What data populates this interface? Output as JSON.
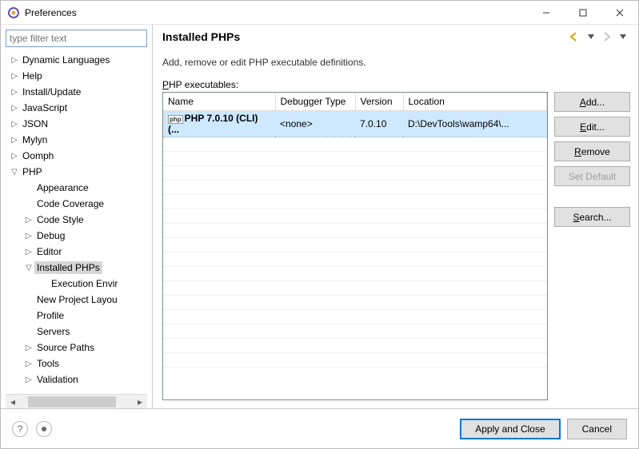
{
  "window": {
    "title": "Preferences"
  },
  "filter": {
    "placeholder": "type filter text"
  },
  "tree": {
    "dynamic_languages": "Dynamic Languages",
    "help": "Help",
    "install_update": "Install/Update",
    "javascript": "JavaScript",
    "json": "JSON",
    "mylyn": "Mylyn",
    "oomph": "Oomph",
    "php": "PHP",
    "appearance": "Appearance",
    "code_coverage": "Code Coverage",
    "code_style": "Code Style",
    "debug": "Debug",
    "editor": "Editor",
    "installed_phps": "Installed PHPs",
    "execution_env": "Execution Envir",
    "new_project": "New Project Layou",
    "profile": "Profile",
    "servers": "Servers",
    "source_paths": "Source Paths",
    "tools": "Tools",
    "validation": "Validation"
  },
  "page": {
    "title": "Installed PHPs",
    "desc": "Add, remove or edit PHP executable definitions.",
    "subhead_prefix": "P",
    "subhead_rest": "HP executables:"
  },
  "table": {
    "col_name": "Name",
    "col_debugger": "Debugger Type",
    "col_version": "Version",
    "col_location": "Location",
    "row": {
      "name": "PHP 7.0.10 (CLI) (...",
      "debugger": "<none>",
      "version": "7.0.10",
      "location": "D:\\DevTools\\wamp64\\..."
    }
  },
  "buttons": {
    "add_u": "A",
    "add_rest": "dd...",
    "edit_u": "E",
    "edit_rest": "dit...",
    "remove_u": "R",
    "remove_rest": "emove",
    "set_default": "Set Default",
    "search_u": "S",
    "search_rest": "earch..."
  },
  "footer": {
    "apply": "Apply and Close",
    "cancel": "Cancel"
  }
}
